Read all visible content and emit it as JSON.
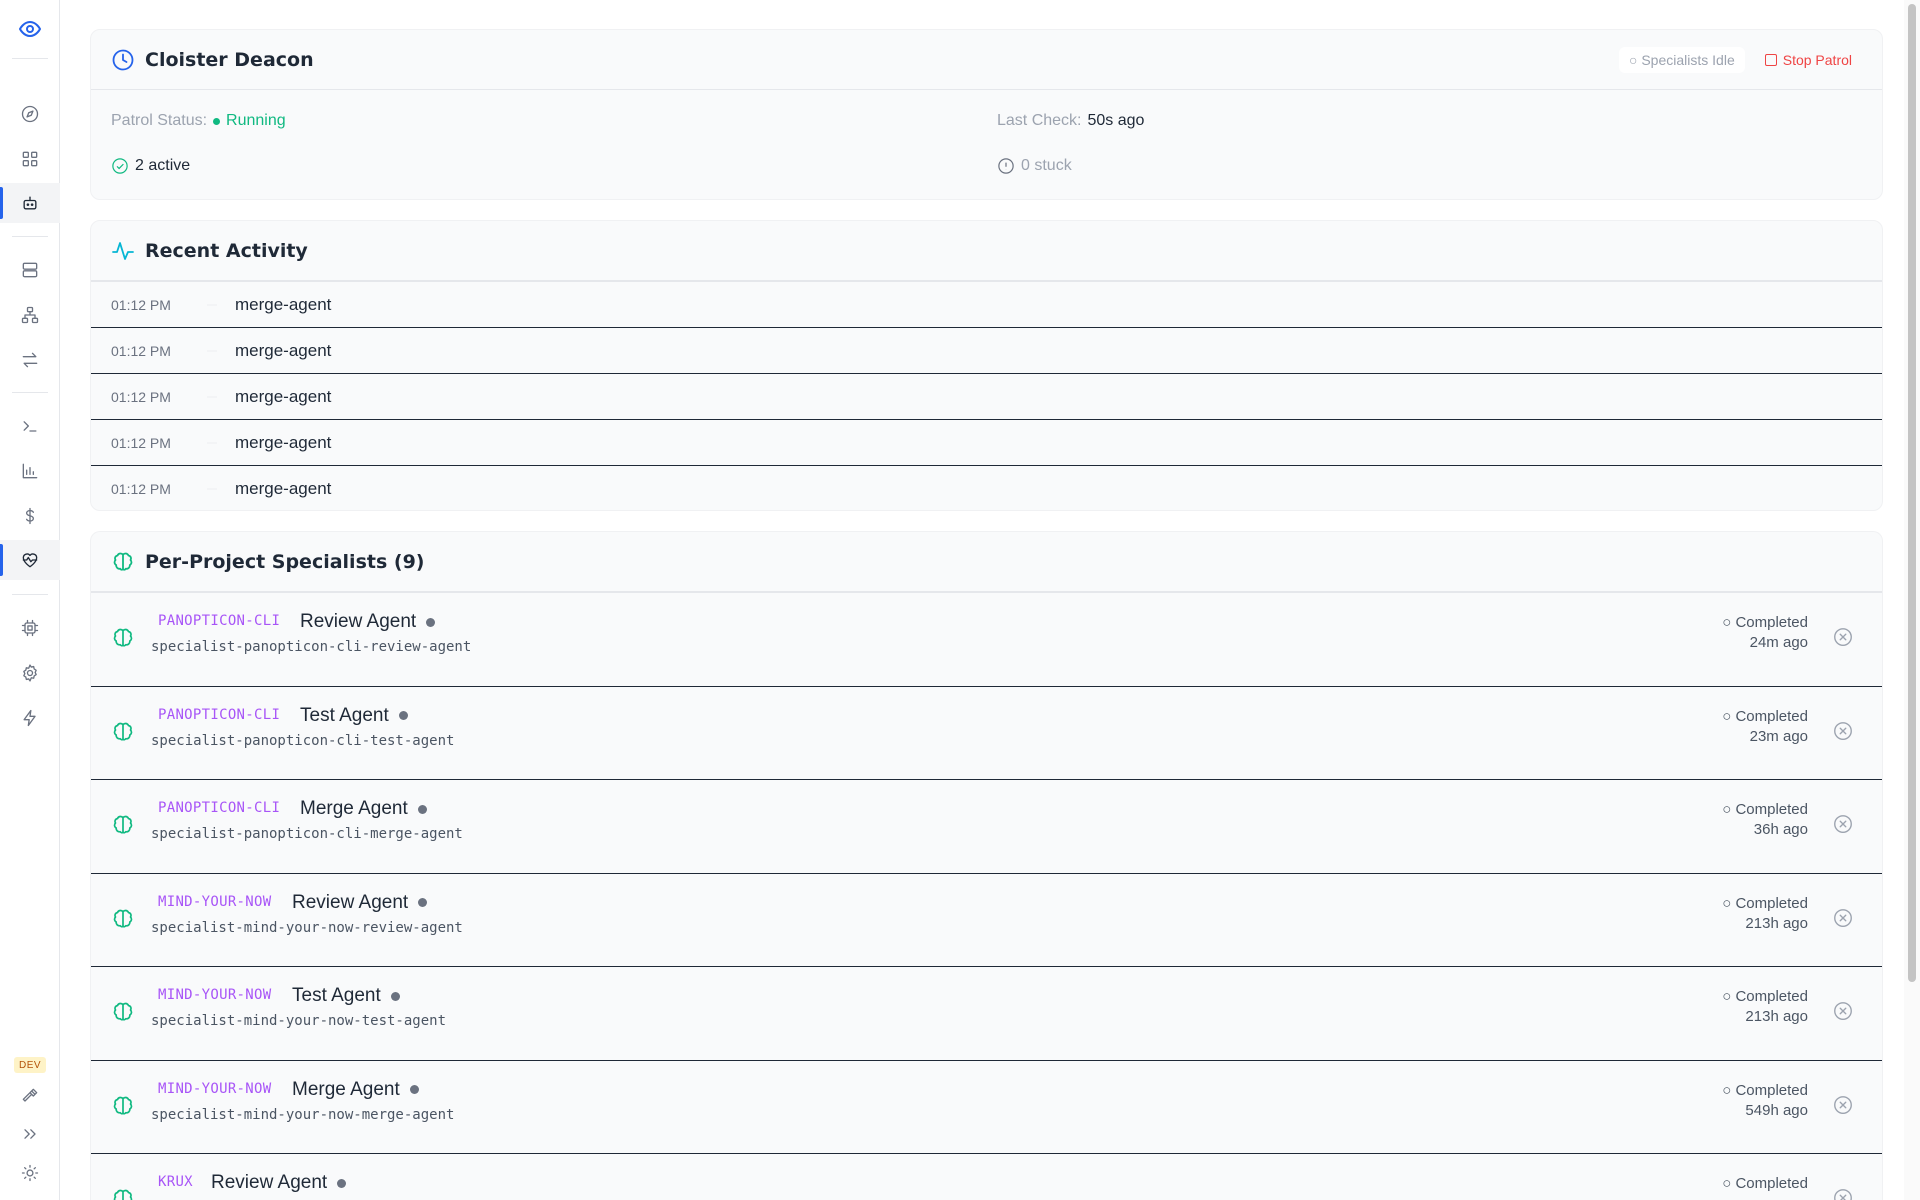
{
  "sidebar": {
    "items": [
      {
        "name": "logo-eye-icon",
        "icon": "eye"
      },
      {
        "name": "compass-icon",
        "icon": "compass"
      },
      {
        "name": "grid-icon",
        "icon": "grid"
      },
      {
        "name": "bot-icon",
        "icon": "bot",
        "active": true
      },
      {
        "name": "server-icon",
        "icon": "server"
      },
      {
        "name": "network-icon",
        "icon": "network"
      },
      {
        "name": "swap-icon",
        "icon": "swap"
      },
      {
        "name": "terminal-icon",
        "icon": "terminal"
      },
      {
        "name": "bar-chart-icon",
        "icon": "bar-chart"
      },
      {
        "name": "dollar-icon",
        "icon": "dollar"
      },
      {
        "name": "heart-pulse-icon",
        "icon": "heart-pulse",
        "active": true
      },
      {
        "name": "cpu-icon",
        "icon": "cpu"
      },
      {
        "name": "gear-icon",
        "icon": "gear"
      },
      {
        "name": "zap-icon",
        "icon": "zap"
      },
      {
        "name": "hammer-icon",
        "icon": "hammer"
      },
      {
        "name": "chevrons-right-icon",
        "icon": "chevrons-right"
      },
      {
        "name": "sun-icon",
        "icon": "sun"
      }
    ],
    "dev_badge": "DEV"
  },
  "deacon": {
    "title": "Cloister Deacon",
    "idle_label": "○ Specialists Idle",
    "stop_label": "Stop Patrol",
    "patrol_label": "Patrol Status:",
    "patrol_value": "Running",
    "last_check_label": "Last Check:",
    "last_check_value": "50s ago",
    "active": "2 active",
    "stuck": "0 stuck",
    "colors": {
      "running": "#10b981",
      "stop": "#ef4444",
      "accent": "#2563eb"
    }
  },
  "activity": {
    "title": "Recent Activity",
    "rows": [
      {
        "time": "01:12 PM",
        "name": "merge-agent"
      },
      {
        "time": "01:12 PM",
        "name": "merge-agent"
      },
      {
        "time": "01:12 PM",
        "name": "merge-agent"
      },
      {
        "time": "01:12 PM",
        "name": "merge-agent"
      },
      {
        "time": "01:12 PM",
        "name": "merge-agent"
      }
    ]
  },
  "specialists": {
    "title": "Per-Project Specialists (9)",
    "rows": [
      {
        "project": "PANOPTICON-CLI",
        "name": "Review Agent",
        "id": "specialist-panopticon-cli-review-agent",
        "status": "○ Completed",
        "ago": "24m ago"
      },
      {
        "project": "PANOPTICON-CLI",
        "name": "Test Agent",
        "id": "specialist-panopticon-cli-test-agent",
        "status": "○ Completed",
        "ago": "23m ago"
      },
      {
        "project": "PANOPTICON-CLI",
        "name": "Merge Agent",
        "id": "specialist-panopticon-cli-merge-agent",
        "status": "○ Completed",
        "ago": "36h ago"
      },
      {
        "project": "MIND-YOUR-NOW",
        "name": "Review Agent",
        "id": "specialist-mind-your-now-review-agent",
        "status": "○ Completed",
        "ago": "213h ago"
      },
      {
        "project": "MIND-YOUR-NOW",
        "name": "Test Agent",
        "id": "specialist-mind-your-now-test-agent",
        "status": "○ Completed",
        "ago": "213h ago"
      },
      {
        "project": "MIND-YOUR-NOW",
        "name": "Merge Agent",
        "id": "specialist-mind-your-now-merge-agent",
        "status": "○ Completed",
        "ago": "549h ago"
      },
      {
        "project": "KRUX",
        "name": "Review Agent",
        "id": "",
        "status": "○ Completed",
        "ago": ""
      }
    ]
  }
}
